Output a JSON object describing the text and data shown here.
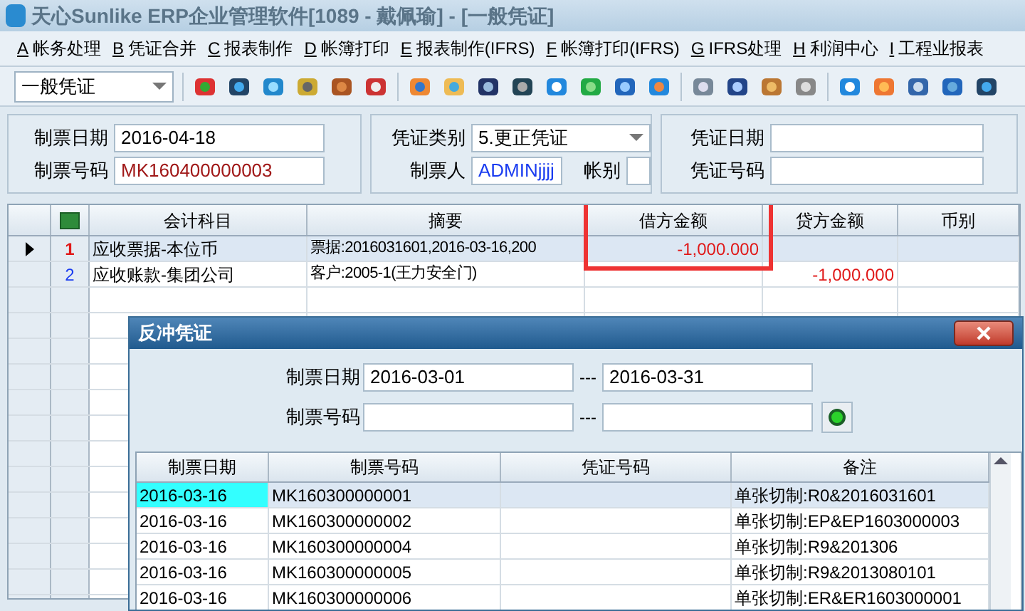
{
  "window": {
    "title": "天心Sunlike ERP企业管理软件[1089 - 戴佩瑜] - [一般凭证]"
  },
  "menu": [
    {
      "key": "A",
      "label": "帐务处理"
    },
    {
      "key": "B",
      "label": "凭证合并"
    },
    {
      "key": "C",
      "label": "报表制作"
    },
    {
      "key": "D",
      "label": "帐簿打印"
    },
    {
      "key": "E",
      "label": "报表制作(IFRS)"
    },
    {
      "key": "F",
      "label": "帐簿打印(IFRS)"
    },
    {
      "key": "G",
      "label": "IFRS处理"
    },
    {
      "key": "H",
      "label": "利润中心"
    },
    {
      "key": "I",
      "label": "工程业报表"
    }
  ],
  "toolbar": {
    "voucher_type": "一般凭证"
  },
  "header": {
    "date_label": "制票日期",
    "date": "2016-04-18",
    "number_label": "制票号码",
    "number": "MK160400000003",
    "category_label": "凭证类别",
    "category": "5.更正凭证",
    "maker_label": "制票人",
    "maker": "ADMINjjjj",
    "book_label": "帐别",
    "voucher_date_label": "凭证日期",
    "voucher_no_label": "凭证号码"
  },
  "grid": {
    "columns": [
      "会计科目",
      "摘要",
      "借方金额",
      "贷方金额",
      "币别"
    ],
    "rows": [
      {
        "no": "1",
        "selected": true,
        "cells": [
          "应收票据-本位币",
          "票据:2016031601,2016-03-16,200",
          "-1,000.000",
          "",
          ""
        ]
      },
      {
        "no": "2",
        "selected": false,
        "cells": [
          "应收账款-集团公司",
          "客户:2005-1(王力安全门)",
          "",
          "-1,000.000",
          ""
        ]
      }
    ]
  },
  "dialog": {
    "title": "反冲凭证",
    "date_label": "制票日期",
    "date_from": "2016-03-01",
    "sep1": "---",
    "date_to": "2016-03-31",
    "number_label": "制票号码",
    "sep2": "---",
    "columns": [
      "制票日期",
      "制票号码",
      "凭证号码",
      "备注"
    ],
    "rows": [
      {
        "selected": true,
        "cells": [
          "2016-03-16",
          "MK160300000001",
          "",
          "单张切制:R0&2016031601"
        ]
      },
      {
        "selected": false,
        "cells": [
          "2016-03-16",
          "MK160300000002",
          "",
          "单张切制:EP&EP1603000003"
        ]
      },
      {
        "selected": false,
        "cells": [
          "2016-03-16",
          "MK160300000004",
          "",
          "单张切制:R9&201306"
        ]
      },
      {
        "selected": false,
        "cells": [
          "2016-03-16",
          "MK160300000005",
          "",
          "单张切制:R9&2013080101"
        ]
      },
      {
        "selected": false,
        "cells": [
          "2016-03-16",
          "MK160300000006",
          "",
          "单张切制:ER&ER1603000001"
        ]
      }
    ]
  }
}
